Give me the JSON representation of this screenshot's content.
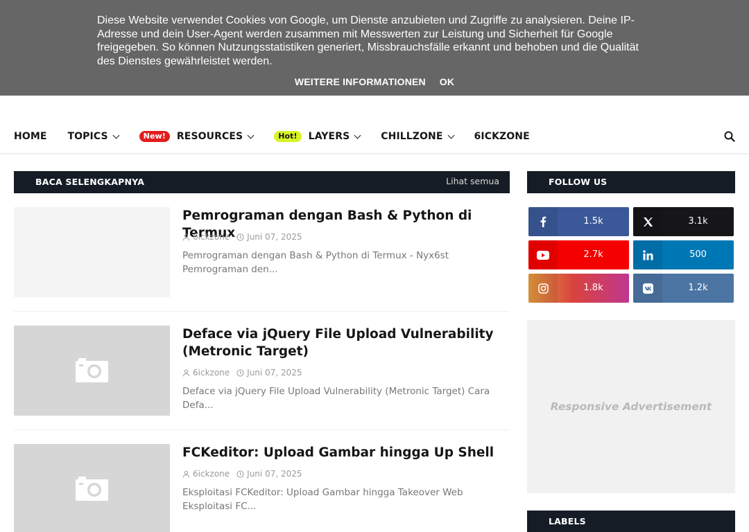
{
  "cookie_banner": {
    "text": "Diese Website verwendet Cookies von Google, um Dienste anzubieten und Zugriffe zu analysieren. Deine IP-Adresse und dein User-Agent werden zusammen mit Messwerten zur Leistung und Sicherheit für Google freigegeben. So können Nutzungsstatistiken generiert, Missbrauchsfälle erkannt und behoben und die Qualität des Dienstes gewährleistet werden.",
    "more_info_label": "WEITERE INFORMATIONEN",
    "ok_label": "OK"
  },
  "nav": {
    "items": [
      {
        "label": "HOME",
        "badge": "",
        "dropdown": false
      },
      {
        "label": "TOPICS",
        "badge": "",
        "dropdown": true
      },
      {
        "label": "RESOURCES",
        "badge": "New!",
        "dropdown": true
      },
      {
        "label": "LAYERS",
        "badge": "Hot!",
        "dropdown": true
      },
      {
        "label": "CHILLZONE",
        "badge": "",
        "dropdown": true
      },
      {
        "label": "6ICKZONE",
        "badge": "",
        "dropdown": false
      }
    ],
    "search_icon": "search-icon"
  },
  "main_section": {
    "title": "BACA SELENGKAPNYA",
    "view_all": "Lihat semua"
  },
  "posts": [
    {
      "title": "Pemrograman dengan Bash & Python di Termux",
      "author": "6ickzone",
      "date": "Juni 07, 2025",
      "excerpt": "Pemrograman dengan Bash & Python di Termux - Nyx6st Pemrograman den..."
    },
    {
      "title": "Deface via jQuery File Upload Vulnerability (Metronic Target)",
      "author": "6ickzone",
      "date": "Juni 07, 2025",
      "excerpt": "Deface via jQuery File Upload Vulnerability (Metronic Target) Cara Defa..."
    },
    {
      "title": "FCKeditor: Upload Gambar hingga Up Shell",
      "author": "6ickzone",
      "date": "Juni 07, 2025",
      "excerpt": "Eksploitasi FCKeditor: Upload Gambar hingga Takeover Web Eksploitasi FC..."
    }
  ],
  "sidebar": {
    "follow_title": "FOLLOW US",
    "social": [
      {
        "network": "facebook",
        "icon": "facebook-icon",
        "count": "1.5k",
        "color": "#3b5998"
      },
      {
        "network": "x",
        "icon": "x-icon",
        "count": "3.1k",
        "color": "#161619"
      },
      {
        "network": "youtube",
        "icon": "youtube-icon",
        "count": "2.7k",
        "color": "#f50000"
      },
      {
        "network": "linkedin",
        "icon": "linkedin-icon",
        "count": "500",
        "color": "#0077b5"
      },
      {
        "network": "instagram",
        "icon": "instagram-icon",
        "count": "1.8k",
        "color": "#c13584"
      },
      {
        "network": "vk",
        "icon": "vk-icon",
        "count": "1.2k",
        "color": "#4c75a3"
      }
    ],
    "ad_label": "Responsive Advertisement",
    "labels_title": "LABELS"
  }
}
